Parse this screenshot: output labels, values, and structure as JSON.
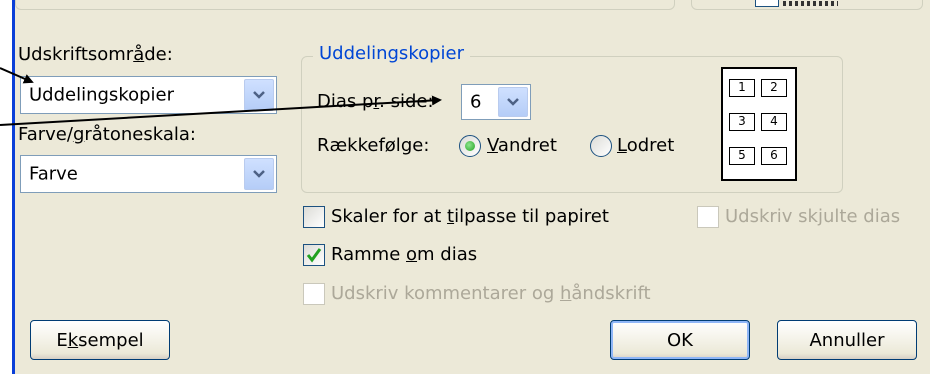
{
  "print_range": {
    "label_pre": "Udskriftsomr",
    "label_key": "å",
    "label_post": "de:",
    "value": "Uddelingskopier"
  },
  "color": {
    "label_pre": "Farve/",
    "label_key": "g",
    "label_post": "råtoneskala:",
    "value": "Farve"
  },
  "handouts": {
    "group_title": "Uddelingskopier",
    "slides_per_page_label_pre": "Dias p",
    "slides_per_page_label_key": "r",
    "slides_per_page_label_post": ". side:",
    "slides_per_page_value": "6",
    "order_label": "Rækkefølge:",
    "horizontal_key": "V",
    "horizontal_rest": "andret",
    "vertical_key": "L",
    "vertical_rest": "odret",
    "preview_numbers": [
      "1",
      "2",
      "3",
      "4",
      "5",
      "6"
    ]
  },
  "options": {
    "scale_pre": "Skaler for at ",
    "scale_key": "t",
    "scale_post": "ilpasse til papiret",
    "scale_checked": false,
    "frame_pre": "Ramme ",
    "frame_key": "o",
    "frame_post": "m dias",
    "frame_checked": true,
    "comments_pre": "Udskriv kommentarer og ",
    "comments_key": "h",
    "comments_post": "åndskrift",
    "hidden_pre": "Udskriv sk",
    "hidden_key": "j",
    "hidden_post": "ulte dias"
  },
  "buttons": {
    "preview_pre": "E",
    "preview_key": "k",
    "preview_post": "sempel",
    "ok": "OK",
    "cancel": "Annuller"
  },
  "colors": {
    "dialog_bg": "#ece9d8",
    "accent_blue": "#0a3fd8",
    "group_title": "#0046d5",
    "disabled": "#aca899"
  }
}
